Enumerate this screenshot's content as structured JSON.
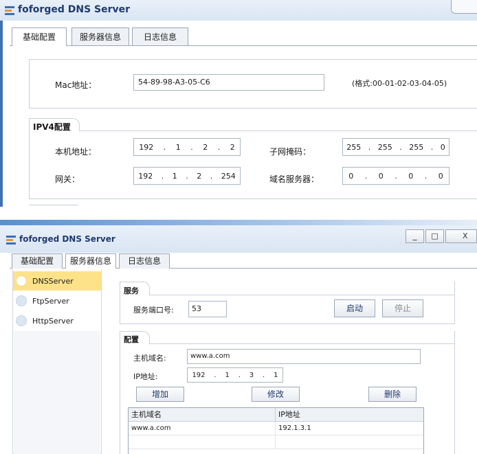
{
  "window1": {
    "title": "foforged DNS Server",
    "tabs": [
      "基础配置",
      "服务器信息",
      "日志信息"
    ],
    "mac_label": "Mac地址：",
    "mac_value": "54-89-98-A3-05-C6",
    "mac_hint": "(格式:00-01-02-03-04-05)",
    "ipv4_group": "IPV4配置",
    "local_ip_label": "本机地址：",
    "local_ip": [
      "192",
      "1",
      "2",
      "2"
    ],
    "subnet_label": "子网掩码：",
    "subnet": [
      "255",
      "255",
      "255",
      "0"
    ],
    "gateway_label": "网关：",
    "gateway": [
      "192",
      "1",
      "2",
      "254"
    ],
    "dns_label": "域名服务器：",
    "dns": [
      "0",
      "0",
      "0",
      "0"
    ]
  },
  "window2": {
    "title": "foforged DNS Server",
    "controls": {
      "minimize": "_",
      "maximize": "□",
      "close": "X"
    },
    "tabs": [
      "基础配置",
      "服务器信息",
      "日志信息"
    ],
    "servers": [
      "DNSServer",
      "FtpServer",
      "HttpServer"
    ],
    "service_group": "服务",
    "port_label": "服务端口号:",
    "port_value": "53",
    "start_button": "启动",
    "stop_button": "停止",
    "config_group": "配置",
    "host_label": "主机域名:",
    "host_value": "www.a.com",
    "ip_label": "IP地址:",
    "ip_value": [
      "192",
      "1",
      "3",
      "1"
    ],
    "add_button": "增加",
    "modify_button": "修改",
    "delete_button": "删除",
    "table": {
      "columns": [
        "主机域名",
        "IP地址"
      ],
      "rows": [
        [
          "www.a.com",
          "192.1.3.1"
        ]
      ]
    }
  },
  "colors": {
    "accent": "#1f3a6e",
    "selected_item": "#fde28a",
    "titlebar": "#dde7f4"
  }
}
